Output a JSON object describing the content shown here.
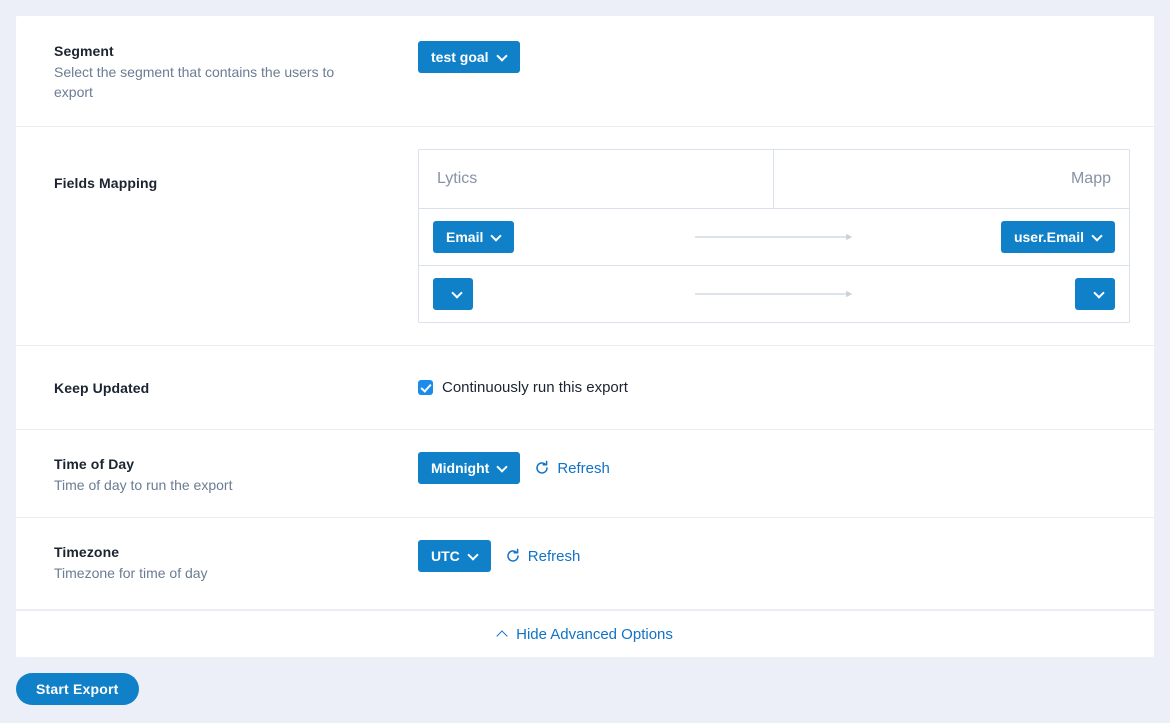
{
  "sections": {
    "segment": {
      "title": "Segment",
      "description": "Select the segment that contains the users to export",
      "selected": "test goal"
    },
    "fields_mapping": {
      "title": "Fields Mapping",
      "columns": [
        "Lytics",
        "Mapp"
      ],
      "rows": [
        {
          "source": "Email",
          "target": "user.Email"
        },
        {
          "source": "",
          "target": ""
        }
      ]
    },
    "keep_updated": {
      "title": "Keep Updated",
      "checkbox_label": "Continuously run this export",
      "checked": true
    },
    "time_of_day": {
      "title": "Time of Day",
      "description": "Time of day to run the export",
      "selected": "Midnight",
      "refresh_label": "Refresh"
    },
    "timezone": {
      "title": "Timezone",
      "description": "Timezone for time of day",
      "selected": "UTC",
      "refresh_label": "Refresh"
    }
  },
  "footer": {
    "advanced_toggle": "Hide Advanced Options",
    "start_export": "Start Export"
  },
  "colors": {
    "accent": "#1081c8",
    "link": "#1272c4",
    "checkbox": "#1a8cf0",
    "page_bg": "#eceff7",
    "divider": "#e9ecf1",
    "table_border": "#dbe1ea",
    "muted_text": "#6b7c93"
  }
}
